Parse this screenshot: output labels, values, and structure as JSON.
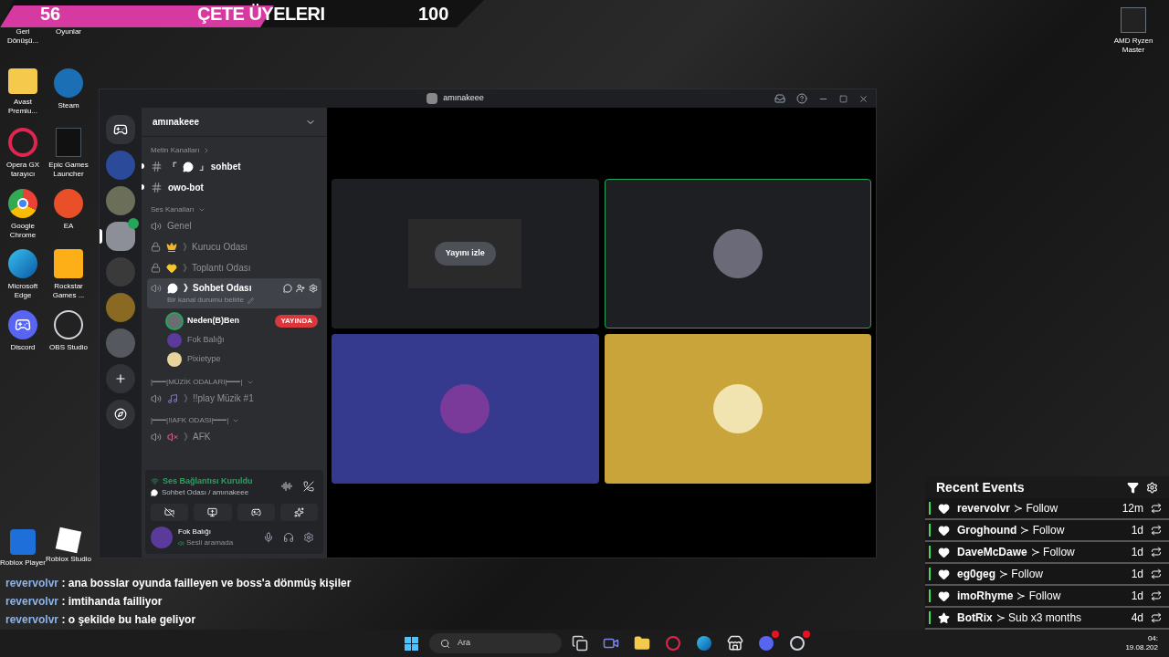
{
  "overlay_bar": {
    "left_count": "56",
    "title": "ÇETE ÜYELERI",
    "right_count": "100"
  },
  "desktop_icons": [
    {
      "label": "Geri Dönüşü..."
    },
    {
      "label": "Oyunlar"
    },
    {
      "label": "Avast Premiu...",
      "kind": "folder"
    },
    {
      "label": "Steam",
      "kind": "steam"
    },
    {
      "label": "Opera GX tarayıcı",
      "kind": "opera"
    },
    {
      "label": "Epic Games Launcher",
      "kind": "epic"
    },
    {
      "label": "Google Chrome",
      "kind": "chrome"
    },
    {
      "label": "EA",
      "kind": "ea"
    },
    {
      "label": "Microsoft Edge",
      "kind": "edge"
    },
    {
      "label": "Rockstar Games ...",
      "kind": "rockstar"
    },
    {
      "label": "Discord",
      "kind": "discord"
    },
    {
      "label": "OBS Studio",
      "kind": "obs"
    },
    {
      "label": "Roblox Player",
      "kind": "roblox"
    },
    {
      "label": "Roblox Studio",
      "kind": "roblox-studio"
    }
  ],
  "corner_icon": {
    "label": "AMD Ryzen Master"
  },
  "discord": {
    "window_title": "amınakeee",
    "servers": [
      {
        "color": "#2c4a9a",
        "selected": false,
        "speaking": false
      },
      {
        "color": "#6b6f5a",
        "selected": false,
        "speaking": false
      },
      {
        "color": "#8d8f98",
        "selected": true,
        "speaking": true
      },
      {
        "color": "#3a3a3a",
        "selected": false,
        "speaking": false
      },
      {
        "color": "#8a6a22",
        "selected": false,
        "speaking": false
      },
      {
        "color": "#55585e",
        "selected": false,
        "speaking": false
      }
    ],
    "server_name": "amınakeee",
    "categories": [
      {
        "label": "Metin Kanalları",
        "expanded": false,
        "channels": [
          {
            "kind": "text",
            "prefix": "「",
            "emoji": {
              "kind": "bubble"
            },
            "name": "」 sohbet",
            "unread": true,
            "selected": false
          },
          {
            "kind": "text",
            "name": "owo-bot",
            "unread": true,
            "selected": false
          }
        ]
      },
      {
        "label": "Ses Kanalları",
        "expanded": true,
        "channels": [
          {
            "kind": "voice",
            "name": "Genel",
            "unread": false,
            "selected": false
          },
          {
            "kind": "locked",
            "emoji": {
              "kind": "crown"
            },
            "name": "》Kurucu Odası",
            "unread": false,
            "selected": false
          },
          {
            "kind": "locked",
            "emoji": {
              "kind": "heart"
            },
            "name": "》Toplantı Odası",
            "unread": false,
            "selected": false
          },
          {
            "kind": "voice",
            "emoji": {
              "kind": "bubble"
            },
            "name": "》Sohbet Odası",
            "unread": false,
            "selected": true,
            "status": "Bir kanal durumu belirle",
            "members": [
              {
                "name": "Neden(B)Ben",
                "speaking": true,
                "badge": "YAYINDA",
                "color": "#6a6e70"
              },
              {
                "name": "Fok Balığı",
                "speaking": false,
                "color": "#5a3a9a"
              },
              {
                "name": "Pixietype",
                "speaking": false,
                "color": "#e8d49a"
              }
            ]
          }
        ]
      },
      {
        "label": "|━━━|MÜZİK ODALARI|━━━|",
        "expanded": true,
        "channels": [
          {
            "kind": "voice",
            "emoji": {
              "kind": "note"
            },
            "name": "》!!play Müzik #1",
            "unread": false,
            "selected": false
          }
        ]
      },
      {
        "label": "|━━━|!!AFK ODASI|━━━|",
        "expanded": true,
        "channels": [
          {
            "kind": "voice",
            "emoji": {
              "kind": "muted"
            },
            "name": "》AFK",
            "unread": false,
            "selected": false
          }
        ]
      }
    ],
    "voice_panel": {
      "status": "Ses Bağlantısı Kuruldu",
      "location": "Sohbet Odası / amınakeee",
      "user": "Fok Balığı",
      "user_status": "Sesli aramada"
    },
    "tiles": [
      {
        "kind": "stream",
        "button": "Yayını izle",
        "color": "#1e1f22",
        "speaking": false
      },
      {
        "kind": "user",
        "color": "#1e1f22",
        "speaking": true,
        "avatar": {
          "color": "#6a6a78"
        }
      },
      {
        "kind": "user",
        "color": "#353a8f",
        "speaking": false,
        "avatar": {
          "color": "#7a3a9a"
        }
      },
      {
        "kind": "user",
        "color": "#c9a43b",
        "speaking": false,
        "avatar": {
          "color": "#f2e4b0"
        }
      }
    ]
  },
  "chat": [
    {
      "user": "revervolvr",
      "text": ": ana bosslar oyunda failleyen ve boss'a dönmüş kişiler"
    },
    {
      "user": "revervolvr",
      "text": ": imtihanda failliyor"
    },
    {
      "user": "revervolvr",
      "text": ": o şekilde bu hale geliyor"
    }
  ],
  "recent_events": {
    "title": "Recent Events",
    "events": [
      {
        "kind": "follow",
        "user": "revervolvr",
        "action": "≻ Follow",
        "time": "12m"
      },
      {
        "kind": "follow",
        "user": "Groghound",
        "action": "≻ Follow",
        "time": "1d"
      },
      {
        "kind": "follow",
        "user": "DaveMcDawe",
        "action": "≻ Follow",
        "time": "1d"
      },
      {
        "kind": "follow",
        "user": "eg0geg",
        "action": "≻ Follow",
        "time": "1d"
      },
      {
        "kind": "follow",
        "user": "imoRhyme",
        "action": "≻ Follow",
        "time": "1d"
      },
      {
        "kind": "sub",
        "user": "BotRix",
        "action": "≻ Sub x3 months",
        "time": "4d"
      }
    ]
  },
  "taskbar": {
    "search_placeholder": "Ara",
    "apps": [
      {
        "kind": "taskview",
        "badge": false
      },
      {
        "kind": "meet",
        "badge": false
      },
      {
        "kind": "folder",
        "badge": false
      },
      {
        "kind": "opera",
        "badge": false
      },
      {
        "kind": "edge",
        "badge": false
      },
      {
        "kind": "store",
        "badge": false
      },
      {
        "kind": "discord",
        "badge": true
      },
      {
        "kind": "obs",
        "badge": true
      }
    ],
    "time": "04:",
    "date": "19.08.202"
  }
}
